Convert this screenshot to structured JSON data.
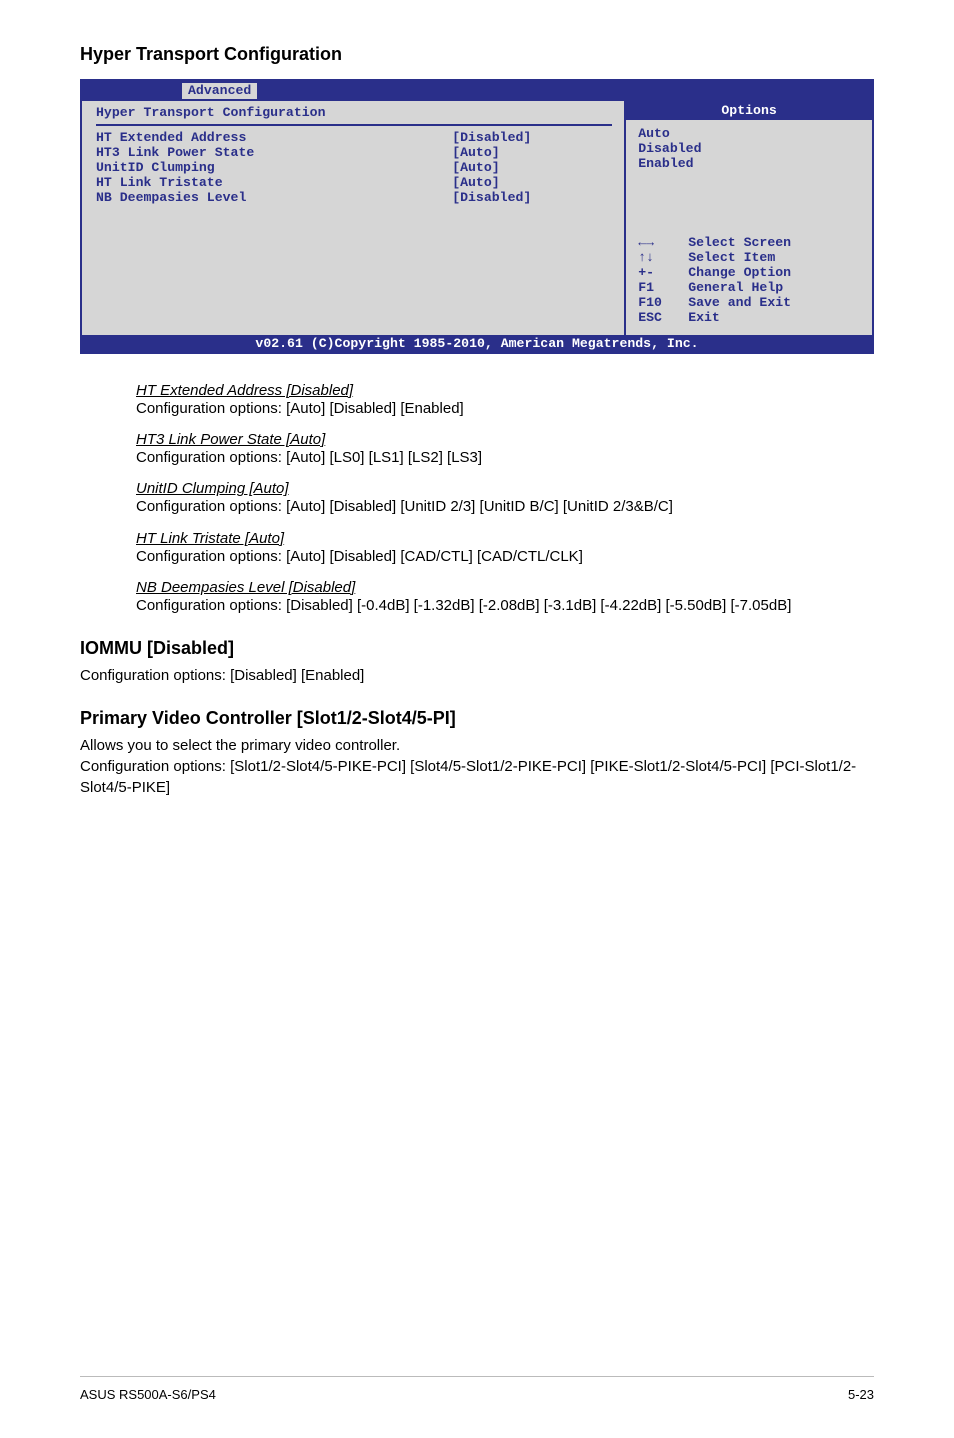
{
  "heading": "Hyper Transport Configuration",
  "bios": {
    "tab": "Advanced",
    "panel_title": "Hyper Transport Configuration",
    "settings": [
      {
        "label": "HT Extended Address",
        "value": "[Disabled]"
      },
      {
        "label": "HT3 Link Power State",
        "value": "[Auto]"
      },
      {
        "label": "UnitID Clumping",
        "value": "[Auto]"
      },
      {
        "label": "HT Link Tristate",
        "value": "[Auto]"
      },
      {
        "label": "NB Deempasies Level",
        "value": "[Disabled]"
      }
    ],
    "options_title": "Options",
    "options": [
      "Auto",
      "Disabled",
      "Enabled"
    ],
    "nav": [
      {
        "key": "←→",
        "action": "Select Screen"
      },
      {
        "key": "↑↓",
        "action": "Select Item"
      },
      {
        "key": "+-",
        "action": "Change Option"
      },
      {
        "key": "F1",
        "action": "General Help"
      },
      {
        "key": "F10",
        "action": "Save and Exit"
      },
      {
        "key": "ESC",
        "action": "Exit"
      }
    ],
    "copyright": "v02.61 (C)Copyright 1985-2010, American Megatrends, Inc."
  },
  "items": [
    {
      "title": "HT Extended Address [Disabled]",
      "body": "Configuration options: [Auto] [Disabled] [Enabled]"
    },
    {
      "title": "HT3 Link Power State [Auto]",
      "body": "Configuration options: [Auto] [LS0] [LS1] [LS2] [LS3]"
    },
    {
      "title": "UnitID Clumping [Auto]",
      "body": "Configuration options: [Auto] [Disabled] [UnitID 2/3] [UnitID B/C] [UnitID 2/3&B/C]"
    },
    {
      "title": "HT Link Tristate [Auto]",
      "body": "Configuration options: [Auto] [Disabled] [CAD/CTL] [CAD/CTL/CLK]"
    },
    {
      "title": "NB Deempasies Level [Disabled]",
      "body": "Configuration options: [Disabled] [-0.4dB] [-1.32dB] [-2.08dB] [-3.1dB] [-4.22dB] [-5.50dB] [-7.05dB]"
    }
  ],
  "iommu": {
    "heading": "IOMMU [Disabled]",
    "body": "Configuration options: [Disabled] [Enabled]"
  },
  "pvc": {
    "heading": "Primary Video Controller [Slot1/2-Slot4/5-PI]",
    "body": "Allows you to select the primary video controller.\nConfiguration options: [Slot1/2-Slot4/5-PIKE-PCI] [Slot4/5-Slot1/2-PIKE-PCI] [PIKE-Slot1/2-Slot4/5-PCI] [PCI-Slot1/2-Slot4/5-PIKE]"
  },
  "footer": {
    "left": "ASUS RS500A-S6/PS4",
    "right": "5-23"
  }
}
